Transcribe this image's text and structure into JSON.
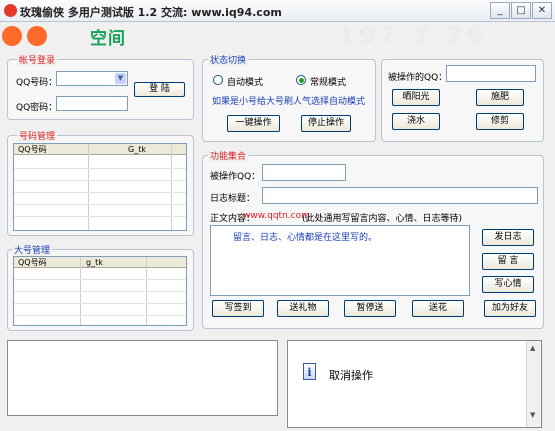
{
  "window": {
    "title": "玫瑰偷侠 多用户测试版 1.2   交流: www.iq94.com",
    "controls": {
      "minimize": "_",
      "maximize": "□",
      "close": "✕"
    }
  },
  "brand": {
    "text": "空间",
    "watermark": "197 Y 79"
  },
  "account_login": {
    "title": "帐号登录",
    "qq_label": "QQ号码：",
    "pwd_label": "QQ密码：",
    "login_button": "登 陆"
  },
  "account_manage": {
    "title": "号码管理",
    "columns": [
      "QQ号码",
      "G_tk"
    ]
  },
  "big_account": {
    "title": "大号管理",
    "columns": [
      "QQ号码",
      "g_tk"
    ]
  },
  "status_switch": {
    "title": "状态切换",
    "auto_mode": "自动模式",
    "normal_mode": "常规模式",
    "hint": "如果是小号给大号刷人气选择自动模式",
    "one_click": "一键操作",
    "stop": "停止操作"
  },
  "target_ops": {
    "target_label": "被操作的QQ：",
    "sunshine": "晒阳光",
    "fertilize": "施肥",
    "water": "浇水",
    "prune": "修剪"
  },
  "features": {
    "title": "功能集合",
    "target_label": "被操作QQ：",
    "log_title_label": "日志标题：",
    "content_label": "正文内容：",
    "content_watermark": "www.qqtn.com",
    "content_note": "(此处通用写留言内容、心情、日志等待)",
    "content_text": "留言、日志、心情都是在这里写的。",
    "post_log": "发日志",
    "message": "留 言",
    "mood": "写心情",
    "sign": "写签到",
    "gift": "送礼物",
    "pause": "暂停送",
    "flower": "送花",
    "add_friend": "加为好友"
  },
  "status_panel": {
    "info_icon": "info-icon",
    "text": "取消操作"
  },
  "colors": {
    "group_title_red": "#dd2222",
    "group_title_blue": "#1a3fb7",
    "hint_blue": "#1a3fb7",
    "radio_green": "#21a121"
  }
}
